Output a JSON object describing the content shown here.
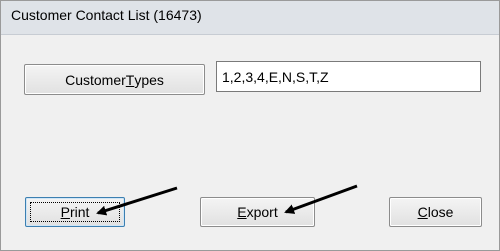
{
  "window": {
    "title": "Customer Contact List (16473)"
  },
  "customer_types": {
    "button_label_prefix": "Customer ",
    "button_label_mnemonic": "T",
    "button_label_suffix": "ypes",
    "value": "1,2,3,4,E,N,S,T,Z"
  },
  "actions": {
    "print_mnemonic": "P",
    "print_rest": "rint",
    "export_mnemonic": "E",
    "export_rest": "xport",
    "close_mnemonic": "C",
    "close_rest": "lose"
  },
  "colors": {
    "titlebar": "#dfe3e8",
    "dialog_bg": "#f0f0f0",
    "focus_border": "#3c7fb1"
  },
  "annotations": {
    "arrow_color": "#000000",
    "arrow_count": 2
  }
}
